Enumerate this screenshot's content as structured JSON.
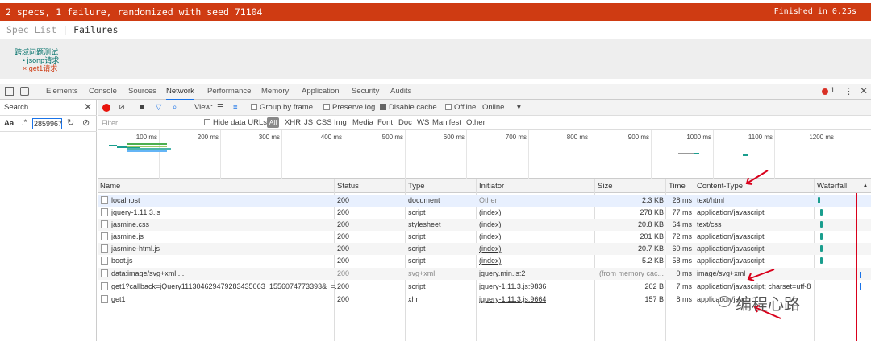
{
  "jasmine": {
    "banner": "2 specs, 1 failure, randomized with seed 71104",
    "finished": "Finished in 0.25s",
    "spec_list": "Spec List",
    "separator": "|",
    "failures": "Failures",
    "suite": "跨域问题测试",
    "spec_pass": "jsonp请求",
    "spec_fail": "get1请求",
    "bullet_pass": "•",
    "bullet_fail": "×"
  },
  "devtools": {
    "tabs": [
      "Elements",
      "Console",
      "Sources",
      "Network",
      "Performance",
      "Memory",
      "Application",
      "Security",
      "Audits"
    ],
    "active_tab": "Network",
    "error_count": "1"
  },
  "search_panel": {
    "label": "Search",
    "aa": "Aa",
    "regex": ".*",
    "query": "2859967"
  },
  "toolbar": {
    "view": "View:",
    "group_by_frame": "Group by frame",
    "preserve_log": "Preserve log",
    "disable_cache": "Disable cache",
    "offline": "Offline",
    "throttle": "Online",
    "dropdown": "▾"
  },
  "filter": {
    "placeholder": "Filter",
    "hide_data_urls": "Hide data URLs",
    "types": [
      "All",
      "XHR",
      "JS",
      "CSS",
      "Img",
      "Media",
      "Font",
      "Doc",
      "WS",
      "Manifest",
      "Other"
    ]
  },
  "overview": {
    "ticks": [
      "100 ms",
      "200 ms",
      "300 ms",
      "400 ms",
      "500 ms",
      "600 ms",
      "700 ms",
      "800 ms",
      "900 ms",
      "1000 ms",
      "1100 ms",
      "1200 ms"
    ]
  },
  "columns": [
    "Name",
    "Status",
    "Type",
    "Initiator",
    "Size",
    "Time",
    "Content-Type",
    "Waterfall"
  ],
  "requests": [
    {
      "name": "localhost",
      "status": "200",
      "type": "document",
      "initiator": "Other",
      "size": "2.3 KB",
      "time": "28 ms",
      "content_type": "text/html"
    },
    {
      "name": "jquery-1.11.3.js",
      "status": "200",
      "type": "script",
      "initiator": "(index)",
      "size": "278 KB",
      "time": "77 ms",
      "content_type": "application/javascript"
    },
    {
      "name": "jasmine.css",
      "status": "200",
      "type": "stylesheet",
      "initiator": "(index)",
      "size": "20.8 KB",
      "time": "64 ms",
      "content_type": "text/css"
    },
    {
      "name": "jasmine.js",
      "status": "200",
      "type": "script",
      "initiator": "(index)",
      "size": "201 KB",
      "time": "72 ms",
      "content_type": "application/javascript"
    },
    {
      "name": "jasmine-html.js",
      "status": "200",
      "type": "script",
      "initiator": "(index)",
      "size": "20.7 KB",
      "time": "60 ms",
      "content_type": "application/javascript"
    },
    {
      "name": "boot.js",
      "status": "200",
      "type": "script",
      "initiator": "(index)",
      "size": "5.2 KB",
      "time": "58 ms",
      "content_type": "application/javascript"
    },
    {
      "name": "data:image/svg+xml;...",
      "status": "200",
      "type": "svg+xml",
      "initiator": "jquery.min.js:2",
      "size": "(from memory cac...",
      "time": "0 ms",
      "content_type": "image/svg+xml"
    },
    {
      "name": "get1?callback=jQuery11130462947928343506З_1556074773393&_=...",
      "status": "200",
      "type": "script",
      "initiator": "jquery-1.11.3.js:9836",
      "size": "202 B",
      "time": "7 ms",
      "content_type": "application/javascript; charset=utf-8"
    },
    {
      "name": "get1",
      "status": "200",
      "type": "xhr",
      "initiator": "jquery-1.11.3.js:9664",
      "size": "157 B",
      "time": "8 ms",
      "content_type": "application/json"
    }
  ],
  "watermark": "编程心路",
  "colors": {
    "banner": "#cf3b12",
    "pass": "#007069",
    "fail": "#cf3b12",
    "accent": "#1a73e8",
    "annotation": "#d9001b"
  }
}
